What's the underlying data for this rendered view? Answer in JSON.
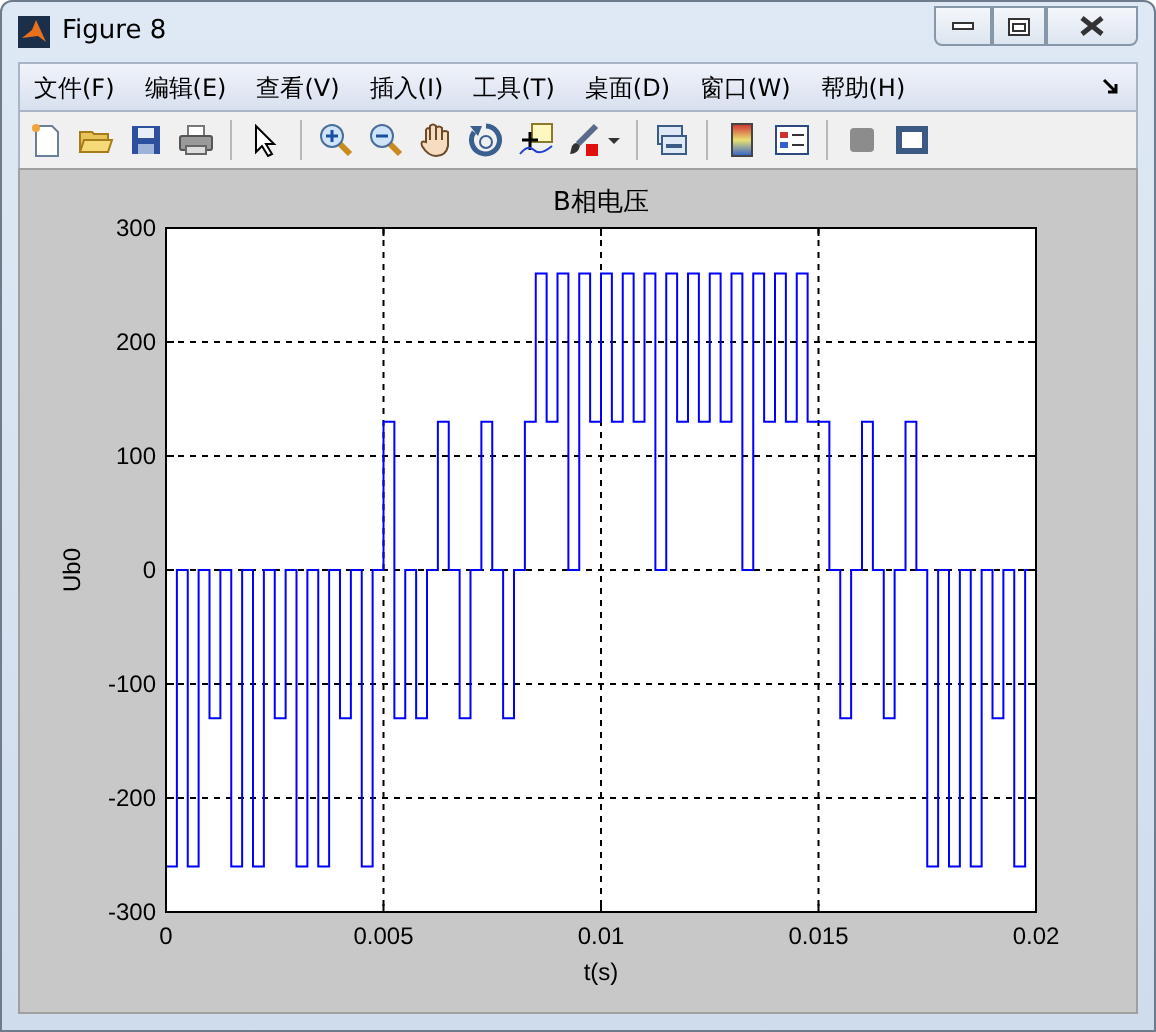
{
  "window": {
    "title": "Figure 8"
  },
  "menu": [
    {
      "label": "文件(F)"
    },
    {
      "label": "编辑(E)"
    },
    {
      "label": "查看(V)"
    },
    {
      "label": "插入(I)"
    },
    {
      "label": "工具(T)"
    },
    {
      "label": "桌面(D)"
    },
    {
      "label": "窗口(W)"
    },
    {
      "label": "帮助(H)"
    }
  ],
  "figure": {
    "chart_data": {
      "type": "line",
      "title": "B相电压",
      "xlabel": "t(s)",
      "ylabel": "Ub0",
      "xlim": [
        0,
        0.02
      ],
      "ylim": [
        -300,
        300
      ],
      "xticks": [
        0,
        0.005,
        0.01,
        0.015,
        0.02
      ],
      "yticks": [
        -300,
        -200,
        -100,
        0,
        100,
        200,
        300
      ],
      "grid": true,
      "x": [
        0,
        0.00025,
        0.00025,
        0.0005,
        0.0005,
        0.00075,
        0.00075,
        0.001,
        0.001,
        0.00125,
        0.00125,
        0.0015,
        0.0015,
        0.00175,
        0.00175,
        0.002,
        0.002,
        0.00225,
        0.00225,
        0.0025,
        0.0025,
        0.00275,
        0.00275,
        0.003,
        0.003,
        0.00325,
        0.00325,
        0.0035,
        0.0035,
        0.00375,
        0.00375,
        0.004,
        0.004,
        0.00425,
        0.00425,
        0.0045,
        0.0045,
        0.00475,
        0.00475,
        0.005,
        0.005,
        0.00525,
        0.00525,
        0.0055,
        0.0055,
        0.00575,
        0.00575,
        0.006,
        0.006,
        0.00625,
        0.00625,
        0.0065,
        0.0065,
        0.00675,
        0.00675,
        0.007,
        0.007,
        0.00725,
        0.00725,
        0.0075,
        0.0075,
        0.00775,
        0.00775,
        0.008,
        0.008,
        0.00825,
        0.00825,
        0.0085,
        0.0085,
        0.00875,
        0.00875,
        0.009,
        0.009,
        0.00925,
        0.00925,
        0.0095,
        0.0095,
        0.00975,
        0.00975,
        0.01,
        0.01,
        0.01025,
        0.01025,
        0.0105,
        0.0105,
        0.01075,
        0.01075,
        0.011,
        0.011,
        0.01125,
        0.01125,
        0.0115,
        0.0115,
        0.01175,
        0.01175,
        0.012,
        0.012,
        0.01225,
        0.01225,
        0.0125,
        0.0125,
        0.01275,
        0.01275,
        0.013,
        0.013,
        0.01325,
        0.01325,
        0.0135,
        0.0135,
        0.01375,
        0.01375,
        0.014,
        0.014,
        0.01425,
        0.01425,
        0.0145,
        0.0145,
        0.01475,
        0.01475,
        0.015,
        0.015,
        0.01525,
        0.01525,
        0.0155,
        0.0155,
        0.01575,
        0.01575,
        0.016,
        0.016,
        0.01625,
        0.01625,
        0.0165,
        0.0165,
        0.01675,
        0.01675,
        0.017,
        0.017,
        0.01725,
        0.01725,
        0.0175,
        0.0175,
        0.01775,
        0.01775,
        0.018,
        0.018,
        0.01825,
        0.01825,
        0.0185,
        0.0185,
        0.01875,
        0.01875,
        0.019,
        0.019,
        0.01925,
        0.01925,
        0.0195,
        0.0195,
        0.01975,
        0.01975,
        0.02
      ],
      "series": [
        {
          "color": "#0000ff",
          "values": [
            -260,
            -260,
            0,
            0,
            -260,
            -260,
            0,
            0,
            -130,
            -130,
            0,
            0,
            -260,
            -260,
            0,
            0,
            -260,
            -260,
            0,
            0,
            -130,
            -130,
            0,
            0,
            -260,
            -260,
            0,
            0,
            -260,
            -260,
            0,
            0,
            -130,
            -130,
            0,
            0,
            -260,
            -260,
            0,
            0,
            130,
            130,
            -130,
            -130,
            0,
            0,
            -130,
            -130,
            0,
            0,
            130,
            130,
            0,
            0,
            -130,
            -130,
            0,
            0,
            130,
            130,
            0,
            0,
            -130,
            -130,
            0,
            0,
            130,
            130,
            260,
            260,
            130,
            130,
            260,
            260,
            0,
            0,
            260,
            260,
            130,
            130,
            260,
            260,
            130,
            130,
            260,
            260,
            130,
            130,
            260,
            260,
            0,
            0,
            260,
            260,
            130,
            130,
            260,
            260,
            130,
            130,
            260,
            260,
            130,
            130,
            260,
            260,
            0,
            0,
            260,
            260,
            130,
            130,
            260,
            260,
            130,
            130,
            260,
            260,
            130,
            130,
            130,
            130,
            0,
            0,
            -130,
            -130,
            0,
            0,
            130,
            130,
            0,
            0,
            -130,
            -130,
            0,
            0,
            130,
            130,
            0,
            0,
            -260,
            -260,
            0,
            0,
            -260,
            -260,
            0,
            0,
            -260,
            -260,
            0,
            0,
            -130,
            -130,
            0,
            0,
            -260,
            -260,
            0,
            0
          ]
        }
      ]
    }
  }
}
